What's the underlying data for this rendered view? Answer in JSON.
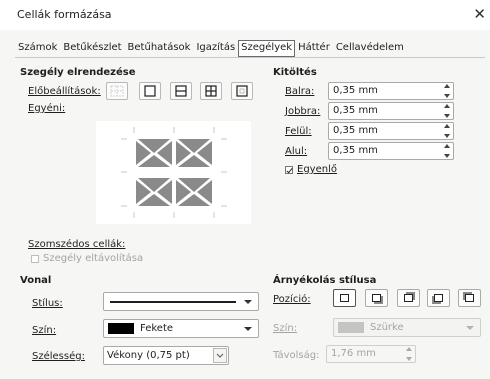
{
  "window": {
    "title": "Cellák formázása",
    "close_glyph": "✕"
  },
  "tabs": [
    "Számok",
    "Betűkészlet",
    "Betűhatások",
    "Igazítás",
    "Szegélyek",
    "Háttér",
    "Cellavédelem"
  ],
  "active_tab": "Szegélyek",
  "border_layout": {
    "heading": "Szegély elrendezése",
    "presets_label": "Előbeállítások:",
    "custom_label": "Egyéni:"
  },
  "padding": {
    "heading": "Kitöltés",
    "fields": [
      {
        "label": "Balra:",
        "value": "0,35 mm"
      },
      {
        "label": "Jobbra:",
        "value": "0,35 mm"
      },
      {
        "label": "Felül:",
        "value": "0,35 mm"
      },
      {
        "label": "Alul:",
        "value": "0,35 mm"
      }
    ],
    "synchronize_label": "Egyenlő",
    "synchronize_checked": true
  },
  "adjacent": {
    "heading": "Szomszédos cellák:",
    "remove_border_label": "Szegély eltávolítása",
    "remove_border_checked": false
  },
  "line": {
    "heading": "Vonal",
    "style_label": "Stílus:",
    "color_label": "Szín:",
    "color_value": "Fekete",
    "color_swatch": "#000000",
    "width_label": "Szélesség:",
    "width_value": "Vékony (0,75 pt)"
  },
  "shadow": {
    "heading": "Árnyékolás stílusa",
    "position_label": "Pozíció:",
    "color_label": "Szín:",
    "color_value": "Szürke",
    "distance_label": "Távolság:",
    "distance_value": "1,76 mm"
  },
  "colors": {
    "dialog_bg": "#f6f6f4",
    "preview_cross": "#8a8a8a",
    "disabled_text": "#a4a4a4"
  }
}
